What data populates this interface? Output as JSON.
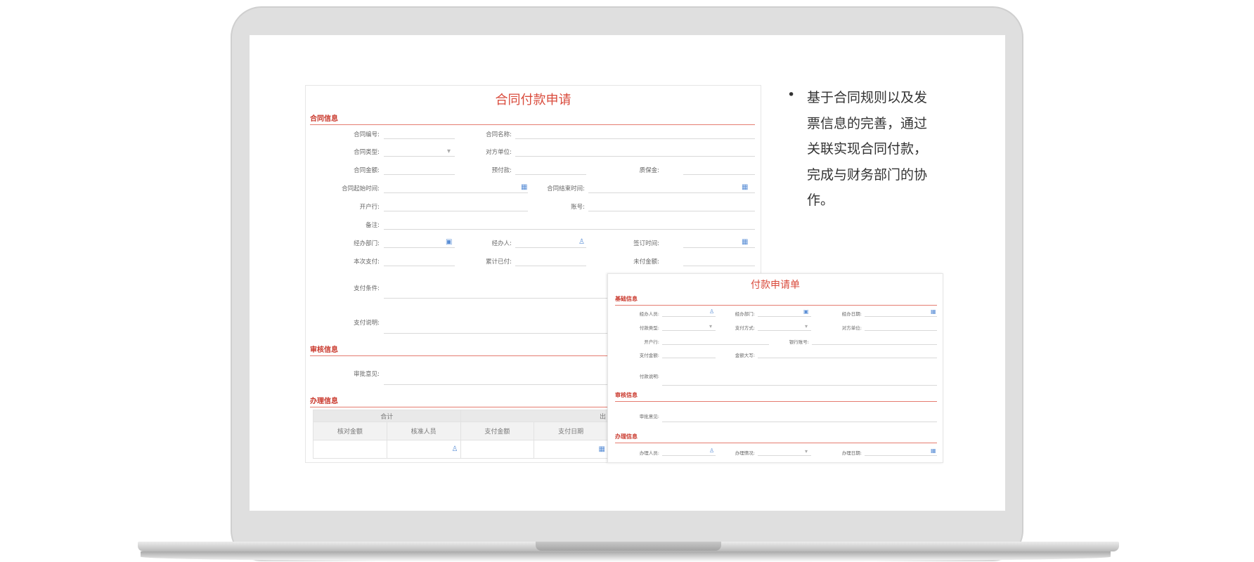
{
  "slide": {
    "bullet": "基于合同规则以及发票信息的完善，通过关联实现合同付款，完成与财务部门的协作。"
  },
  "form1": {
    "title": "合同付款申请",
    "sections": {
      "contract": "合同信息",
      "review": "审核信息",
      "process": "办理信息"
    },
    "labels": {
      "contract_no": "合同编号:",
      "contract_name": "合同名称:",
      "contract_type": "合同类型:",
      "counterparty": "对方单位:",
      "contract_amount": "合同金额:",
      "prepayment": "预付款:",
      "warranty": "质保金:",
      "start_time": "合同起始时间:",
      "end_time": "合同结束时间:",
      "bank": "开户行:",
      "account": "账号:",
      "remark": "备注:",
      "dept": "经办部门:",
      "handler": "经办人:",
      "sign_time": "签订时间:",
      "this_payment": "本次支付:",
      "paid_total": "累计已付:",
      "unpaid": "未付金额:",
      "pay_terms": "支付条件:",
      "pay_desc": "支付说明:",
      "approval": "审批意见:"
    },
    "table": {
      "group_header": "合计",
      "group_header_right": "出",
      "columns": [
        "核对金额",
        "核准人员",
        "支付金额",
        "支付日期"
      ]
    }
  },
  "form2": {
    "title": "付款申请单",
    "sections": {
      "basic": "基础信息",
      "review": "审核信息",
      "process": "办理信息"
    },
    "labels": {
      "handler": "经办人员:",
      "dept": "经办部门:",
      "date": "经办日期:",
      "pay_type": "付款类型:",
      "pay_method": "支付方式:",
      "counterparty": "对方单位:",
      "bank": "开户行:",
      "bank_account": "银行账号:",
      "amount": "支付金额:",
      "amount_caps": "金额大写:",
      "pay_desc": "付款说明:",
      "approval": "审批意见:",
      "proc_person": "办理人员:",
      "proc_status": "办理情况:",
      "proc_date": "办理日期:"
    }
  },
  "icons": {
    "calendar": "calendar-icon",
    "user": "user-icon",
    "org": "org-icon",
    "dropdown": "chevron-down-icon"
  },
  "colors": {
    "accent": "#d94a3b",
    "icon": "#5b8fd6"
  }
}
